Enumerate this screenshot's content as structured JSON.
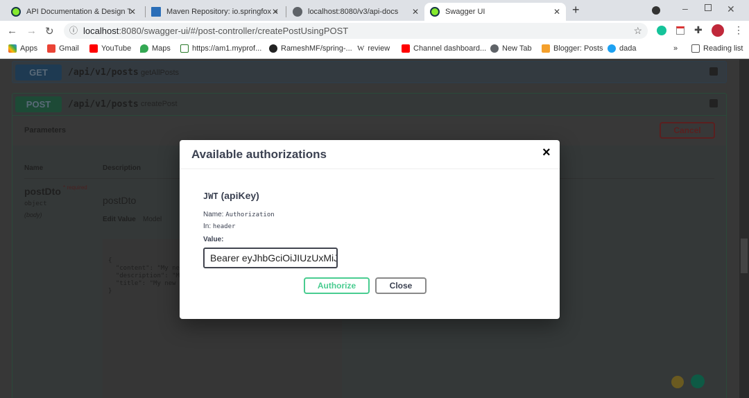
{
  "browser": {
    "tabs": [
      {
        "title": "API Documentation & Design Too",
        "active": false
      },
      {
        "title": "Maven Repository: io.springfox »",
        "active": false
      },
      {
        "title": "localhost:8080/v3/api-docs",
        "active": false
      },
      {
        "title": "Swagger UI",
        "active": true
      }
    ],
    "url_host": "localhost",
    "url_rest": ":8080/swagger-ui/#/post-controller/createPostUsingPOST",
    "bookmarks": [
      "Apps",
      "Gmail",
      "YouTube",
      "Maps",
      "https://am1.myprof...",
      "RameshMF/spring-...",
      "review",
      "Channel dashboard...",
      "New Tab",
      "Blogger: Posts",
      "dada"
    ],
    "reading_list": "Reading list",
    "more": "»"
  },
  "swagger": {
    "ops": [
      {
        "method": "GET",
        "path": "/api/v1/posts",
        "summary": "getAllPosts",
        "color": "#1e3a52"
      },
      {
        "method": "POST",
        "path": "/api/v1/posts",
        "summary": "createPost",
        "color": "#1d4a36"
      }
    ],
    "parameters_label": "Parameters",
    "cancel_label": "Cancel",
    "col_name": "Name",
    "col_description": "Description",
    "param_name": "postDto",
    "required_mark": "*",
    "required_label": "required",
    "param_type": "object",
    "param_in": "(body)",
    "param_desc": "postDto",
    "edit_value": "Edit Value",
    "model": "Model",
    "body_lines": [
      "{",
      "  \"content\": \"My ne",
      "  \"description\": \"M",
      "  \"title\": \"My new",
      "}"
    ]
  },
  "modal": {
    "title": "Available authorizations",
    "close_x": "×",
    "scheme_name": "JWT",
    "scheme_type": "(apiKey)",
    "name_label": "Name:",
    "name_value": "Authorization",
    "in_label": "In:",
    "in_value": "header",
    "value_label": "Value:",
    "value_input": "Bearer eyJhbGciOiJIUzUxMiJ",
    "authorize_label": "Authorize",
    "close_label": "Close",
    "accent": "#49cc90"
  }
}
